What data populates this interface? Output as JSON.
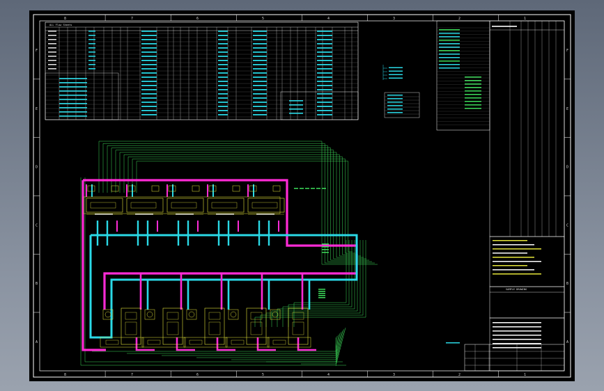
{
  "drawing": {
    "zone_numbers_top": [
      "8",
      "7",
      "6",
      "5",
      "4",
      "3",
      "2",
      "1"
    ],
    "zone_numbers_bottom": [
      "8",
      "7",
      "6",
      "5",
      "4",
      "3",
      "2",
      "1"
    ],
    "zone_letters": [
      "F",
      "E",
      "D",
      "C",
      "B",
      "A"
    ],
    "schedule_header": "ALL Flow Sheets",
    "title_block_headline": "SAMPLE DRAWING",
    "colors": {
      "background": "#000000",
      "frame": "#ffffff",
      "supply_pipe": "#ff2bd6",
      "return_pipe": "#2ad9e6",
      "signal_wire": "#3ddc5a",
      "equipment": "#e6e63a",
      "text_table": "#2ad9e6",
      "text_label": "#ffffff"
    }
  }
}
